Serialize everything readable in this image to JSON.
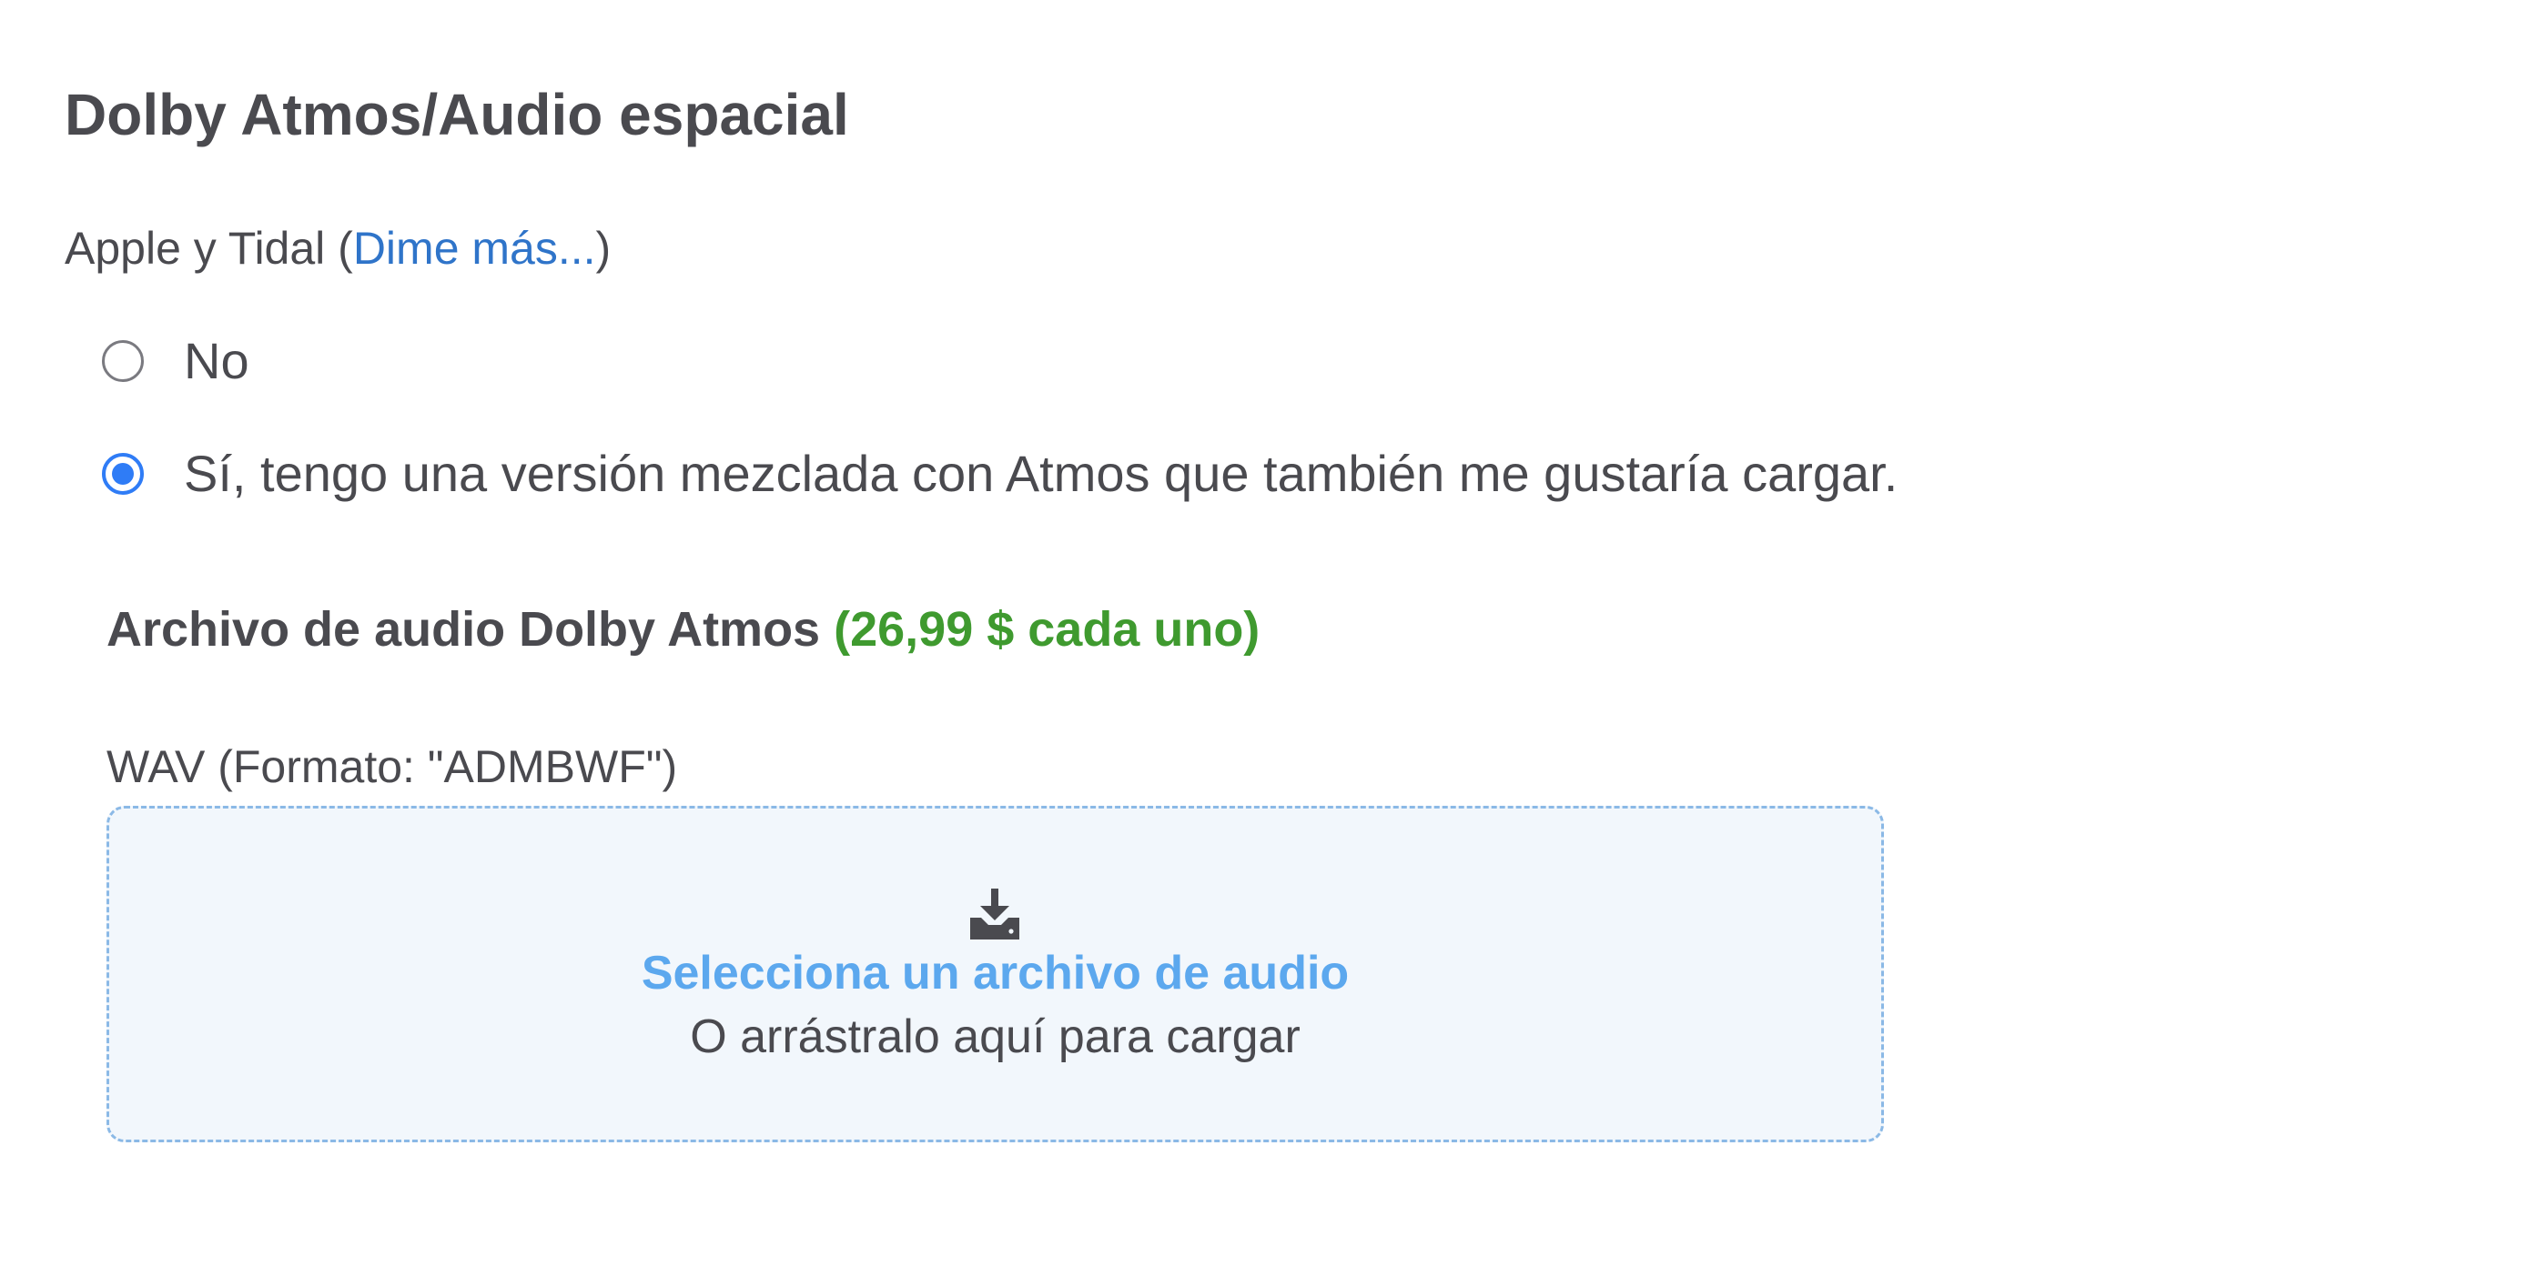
{
  "section": {
    "title": "Dolby Atmos/Audio espacial"
  },
  "question": {
    "prefix": "Apple y Tidal (",
    "link_label": "Dime más...",
    "suffix": ")"
  },
  "options": [
    {
      "label": "No",
      "selected": false
    },
    {
      "label": "Sí, tengo una versión mezclada con Atmos que también me gustaría cargar.",
      "selected": true
    }
  ],
  "file": {
    "title": "Archivo de audio Dolby Atmos",
    "price": "(26,99 $ cada uno)",
    "format_label": "WAV (Formato: \"ADMBWF\")"
  },
  "dropzone": {
    "icon": "download-tray-icon",
    "link_label": "Selecciona un archivo de audio",
    "sub_label": "O arrástralo aquí para cargar"
  },
  "colors": {
    "text": "#4a4a4f",
    "link": "#2f74c9",
    "price": "#3f9a2f",
    "radio_selected": "#2f7cf6",
    "dropzone_bg": "#f2f7fc",
    "dropzone_border": "#8bb9e6",
    "dropzone_link": "#5ca8ee"
  }
}
